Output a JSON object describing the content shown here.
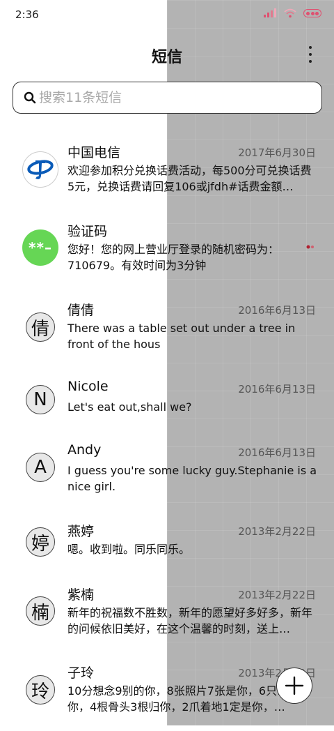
{
  "status_bar": {
    "time": "2:36",
    "icons": [
      "signal-icon",
      "wifi-icon",
      "battery-icon"
    ],
    "accent_color": "#e05070"
  },
  "header": {
    "title": "短信",
    "menu_icon": "more-vertical-icon"
  },
  "search": {
    "placeholder": "搜索11条短信",
    "icon": "search-icon"
  },
  "messages": [
    {
      "name": "中国电信",
      "date": "2017年6月30日",
      "preview": "欢迎参加积分兑换话费活动，每500分可兑换话费5元，兑换话费请回复106或jfdh#话费金额…",
      "avatar": "china-telecom-logo"
    },
    {
      "name": "验证码",
      "date": "",
      "preview": "您好！您的网上营业厅登录的随机密码为：710679。有效时间为3分钟",
      "avatar_text": "**–",
      "avatar_color": "#66d655"
    },
    {
      "name": "倩倩",
      "date": "2016年6月13日",
      "preview": "There was a table set out under a tree in front of the hous",
      "avatar_text": "倩"
    },
    {
      "name": "Nicole",
      "date": "2016年6月13日",
      "preview": "Let's eat out,shall we?",
      "avatar_text": "N"
    },
    {
      "name": "Andy",
      "date": "2016年6月13日",
      "preview": "I guess you're some lucky guy.Stephanie is a nice girl.",
      "avatar_text": "A"
    },
    {
      "name": "燕婷",
      "date": "2013年2月22日",
      "preview": "嗯。收到啦。同乐同乐。",
      "avatar_text": "婷"
    },
    {
      "name": "紫楠",
      "date": "2013年2月22日",
      "preview": "新年的祝福数不胜数，新年的愿望好多好多，新年的问候依旧美好，在这个温馨的时刻，送上…",
      "avatar_text": "楠"
    },
    {
      "name": "子玲",
      "date": "2013年2月22日",
      "preview": "10分想念9别的你，8张照片7张是你，6只…只像你，4根骨头3根归你，2爪着地1定是你，…",
      "avatar_text": "玲"
    }
  ],
  "fab": {
    "icon": "plus-icon"
  }
}
